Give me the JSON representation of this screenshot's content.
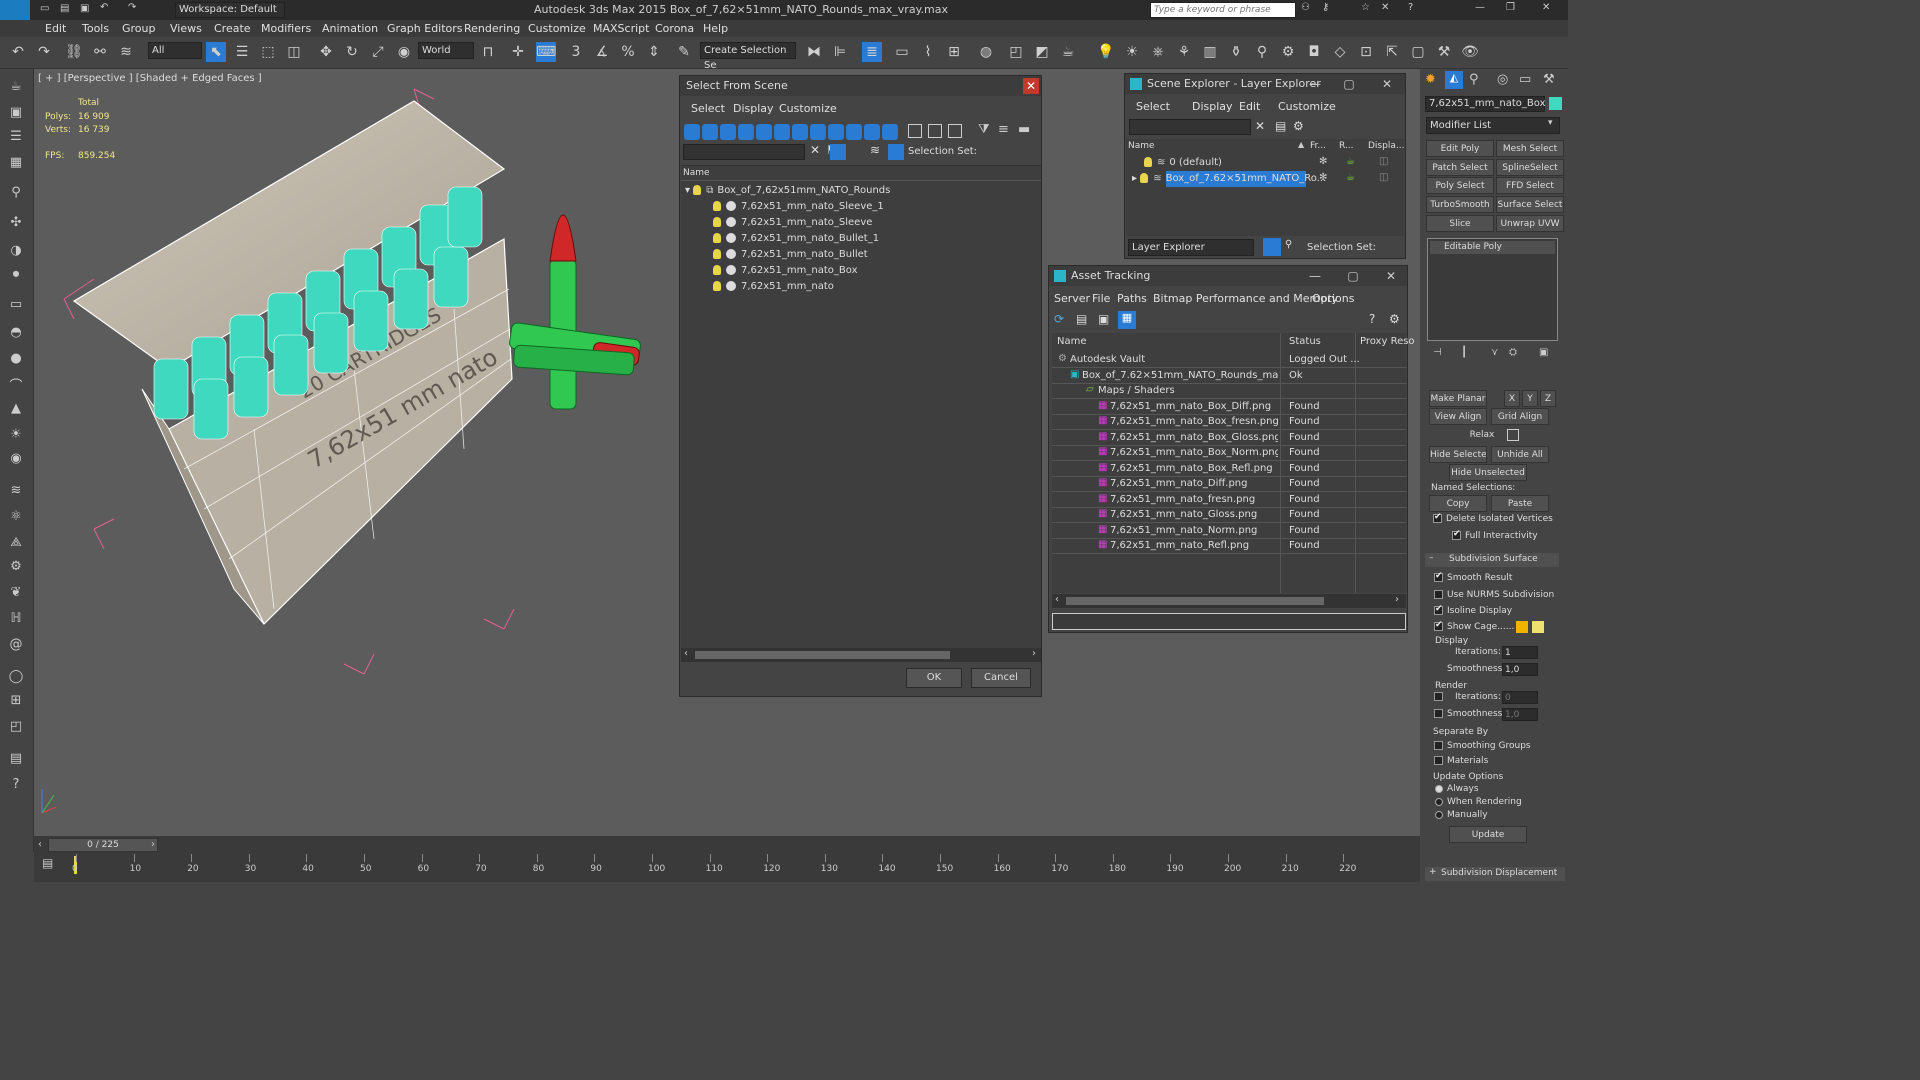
{
  "app": {
    "title": "Autodesk 3ds Max  2015      Box_of_7,62×51mm_NATO_Rounds_max_vray.max",
    "workspace": "Workspace: Default",
    "search_placeholder": "Type a keyword or phrase",
    "logo": "MAX"
  },
  "menu": [
    "Edit",
    "Tools",
    "Group",
    "Views",
    "Create",
    "Modifiers",
    "Animation",
    "Graph Editors",
    "Rendering",
    "Customize",
    "MAXScript",
    "Corona",
    "Help"
  ],
  "toolbar": {
    "filter": "All",
    "coord": "World",
    "selection_set": "Create Selection Se"
  },
  "viewport": {
    "label": "[ + ] [Perspective ] [Shaded + Edged Faces ]",
    "stats_total": "Total",
    "polys_label": "Polys:",
    "polys_value": "16 909",
    "verts_label": "Verts:",
    "verts_value": "16 739",
    "fps_label": "FPS:",
    "fps_value": "859.254"
  },
  "select_from_scene": {
    "title": "Select From Scene",
    "menu": [
      "Select",
      "Display",
      "Customize"
    ],
    "selection_set_label": "Selection Set:",
    "column_name": "Name",
    "root": "Box_of_7,62x51mm_NATO_Rounds",
    "items": [
      "7,62x51_mm_nato_Sleeve_1",
      "7,62x51_mm_nato_Sleeve",
      "7,62x51_mm_nato_Bullet_1",
      "7,62x51_mm_nato_Bullet",
      "7,62x51_mm_nato_Box",
      "7,62x51_mm_nato"
    ],
    "ok": "OK",
    "cancel": "Cancel"
  },
  "scene_explorer": {
    "title": "Scene Explorer - Layer Explorer",
    "menu": [
      "Select",
      "Display",
      "Edit",
      "Customize"
    ],
    "col_name": "Name",
    "col_fr": "Fr...",
    "col_r": "R...",
    "col_display": "Displa...",
    "rows": [
      "0 (default)",
      "Box_of_7.62×51mm_NATO_Ro..."
    ],
    "footer_dropdown": "Layer Explorer",
    "selection_set_label": "Selection Set:"
  },
  "asset_tracking": {
    "title": "Asset Tracking",
    "menu": [
      "Server",
      "File",
      "Paths",
      "Bitmap Performance and Memory",
      "Options"
    ],
    "col_name": "Name",
    "col_status": "Status",
    "col_proxy": "Proxy Reso",
    "rows": [
      {
        "name": "Autodesk Vault",
        "status": "Logged Out ..."
      },
      {
        "name": "Box_of_7.62×51mm_NATO_Rounds_ma...",
        "status": "Ok"
      },
      {
        "name": "Maps / Shaders",
        "status": ""
      },
      {
        "name": "7,62x51_mm_nato_Box_Diff.png",
        "status": "Found"
      },
      {
        "name": "7,62x51_mm_nato_Box_fresn.png",
        "status": "Found"
      },
      {
        "name": "7,62x51_mm_nato_Box_Gloss.png",
        "status": "Found"
      },
      {
        "name": "7,62x51_mm_nato_Box_Norm.png",
        "status": "Found"
      },
      {
        "name": "7,62x51_mm_nato_Box_Refl.png",
        "status": "Found"
      },
      {
        "name": "7,62x51_mm_nato_Diff.png",
        "status": "Found"
      },
      {
        "name": "7,62x51_mm_nato_fresn.png",
        "status": "Found"
      },
      {
        "name": "7,62x51_mm_nato_Gloss.png",
        "status": "Found"
      },
      {
        "name": "7,62x51_mm_nato_Norm.png",
        "status": "Found"
      },
      {
        "name": "7,62x51_mm_nato_Refl.png",
        "status": "Found"
      }
    ]
  },
  "command_panel": {
    "object_name": "7,62x51_mm_nato_Box",
    "modifier_list": "Modifier List",
    "buttons": [
      "Edit Poly",
      "Mesh Select",
      "Patch Select",
      "SplineSelect",
      "Poly Select",
      "FFD Select",
      "TurboSmooth",
      "Surface Select",
      "Slice",
      "Unwrap UVW"
    ],
    "stack_item": "Editable Poly",
    "make_planar": "Make Planar",
    "x": "X",
    "y": "Y",
    "z": "Z",
    "view_align": "View Align",
    "grid_align": "Grid Align",
    "relax": "Relax",
    "hide_selected": "Hide Selected",
    "unhide_all": "Unhide All",
    "hide_unselected": "Hide Unselected",
    "named_selections": "Named Selections:",
    "copy": "Copy",
    "paste": "Paste",
    "delete_isolated": "Delete Isolated Vertices",
    "full_interactivity": "Full Interactivity",
    "subdivision_surface": "Subdivision Surface",
    "smooth_result": "Smooth Result",
    "use_nurms": "Use NURMS Subdivision",
    "isoline_display": "Isoline Display",
    "show_cage": "Show Cage......",
    "display_label": "Display",
    "iterations_label": "Iterations:",
    "iterations_value": "1",
    "smoothness_label": "Smoothness:",
    "smoothness_value": "1,0",
    "render_label": "Render",
    "render_iterations": "0",
    "render_smoothness": "1,0",
    "separate_by": "Separate By",
    "smoothing_groups": "Smoothing Groups",
    "materials": "Materials",
    "update_options": "Update Options",
    "always": "Always",
    "when_rendering": "When Rendering",
    "manually": "Manually",
    "update": "Update",
    "subdivision_displacement": "Subdivision Displacement"
  },
  "timeline": {
    "frame": "0 / 225",
    "ticks": [
      "0",
      "10",
      "20",
      "30",
      "40",
      "50",
      "60",
      "70",
      "80",
      "90",
      "100",
      "110",
      "120",
      "130",
      "140",
      "150",
      "160",
      "170",
      "180",
      "190",
      "200",
      "210",
      "220"
    ]
  },
  "colors": {
    "accent_blue": "#2a7bd4",
    "bulb": "#e8d44d",
    "cage_yellow": "#f0b400",
    "wire_cyan": "#3fd9c0",
    "wire_green": "#30c850",
    "wire_red": "#d02828"
  }
}
